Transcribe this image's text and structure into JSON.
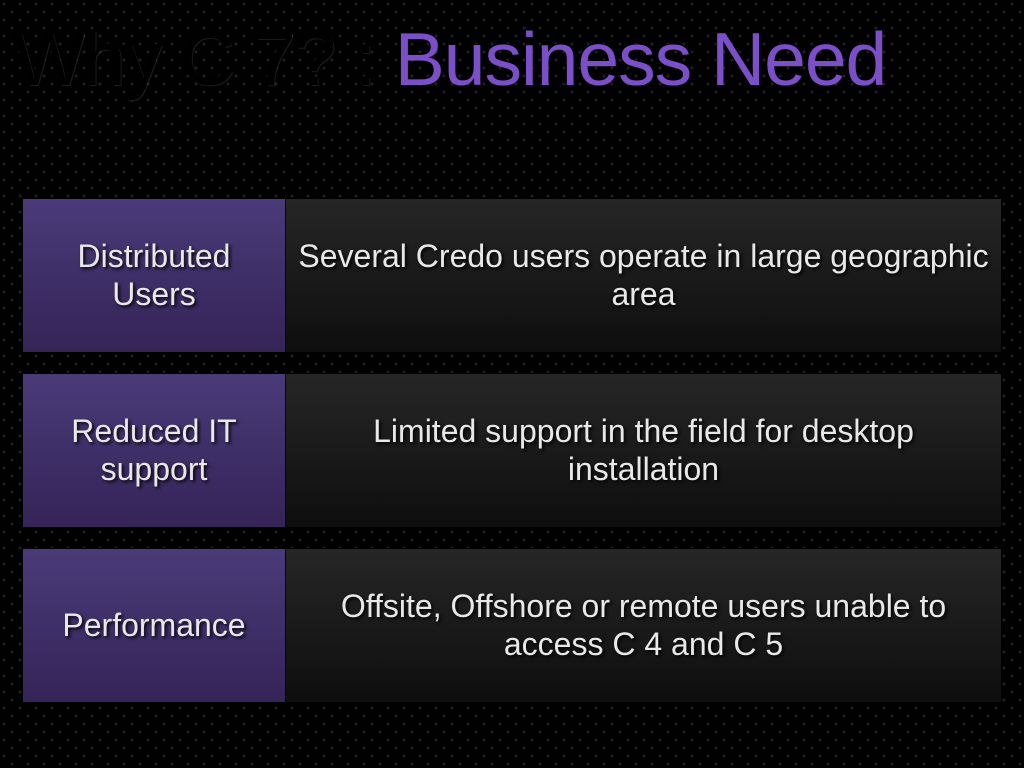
{
  "title": {
    "part1": "Why C 7? : ",
    "part2": "Business Need"
  },
  "rows": [
    {
      "label": "Distributed Users",
      "desc": "Several Credo users operate in large geographic area"
    },
    {
      "label": "Reduced IT support",
      "desc": "Limited support in the field for desktop installation"
    },
    {
      "label": "Performance",
      "desc": "Offsite, Offshore or remote users unable to access C 4 and C 5"
    }
  ]
}
